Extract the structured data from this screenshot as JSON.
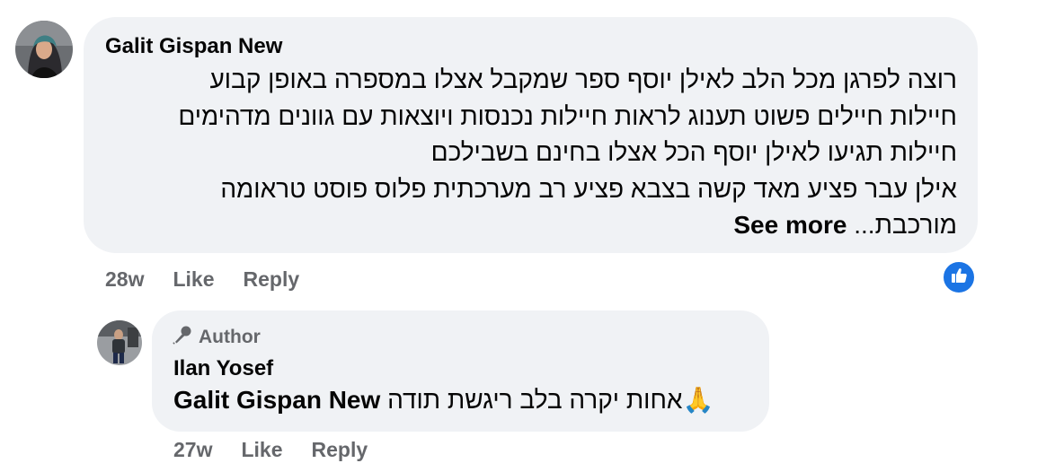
{
  "comment": {
    "author": "Galit Gispan New",
    "lines": [
      "רוצה לפרגן מכל הלב לאילן יוסף ספר שמקבל אצלו במספרה באופן קבוע",
      "חיילות חיילים פשוט תענוג לראות חיילות נכנסות ויוצאות עם גוונים מדהימים",
      "חיילות תגיעו לאילן יוסף הכל אצלו בחינם בשבילכם",
      "אילן עבר פציע מאד קשה בצבא פציע רב מערכתית פלוס פוסט טראומה"
    ],
    "last_line": "מורכבת...",
    "see_more": "See more",
    "time": "28w",
    "like_label": "Like",
    "reply_label": "Reply",
    "reaction_icon": "like-thumb-icon",
    "reaction_color": "#1b74e4"
  },
  "reply": {
    "badge": "Author",
    "badge_icon": "microphone-icon",
    "author": "Ilan Yosef",
    "tag": "Galit Gispan New",
    "text": "אחות יקרה בלב ריגשת תודה",
    "emoji": "🙏",
    "time": "27w",
    "like_label": "Like",
    "reply_label": "Reply"
  }
}
